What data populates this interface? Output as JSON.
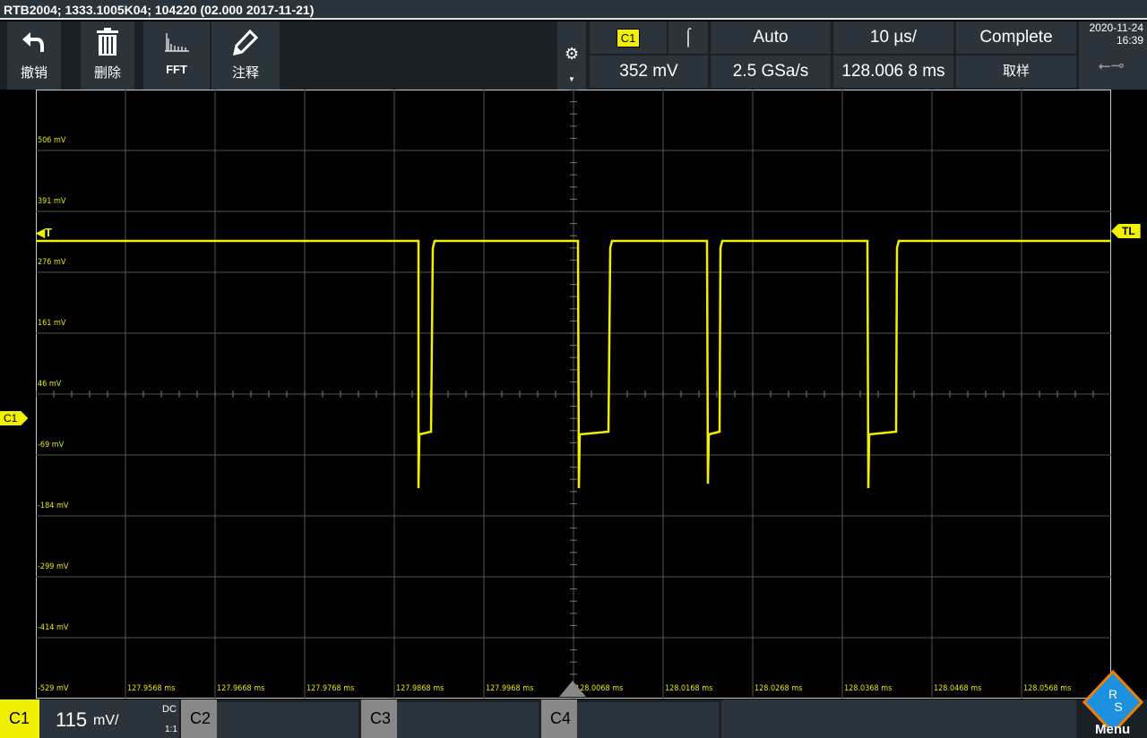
{
  "title": "RTB2004; 1333.1005K04; 104220 (02.000 2017-11-21)",
  "toolbar": [
    {
      "label": "撤销",
      "icon": "undo-icon"
    },
    {
      "label": "删除",
      "icon": "trash-icon"
    },
    {
      "label": "FFT",
      "icon": "fft-icon"
    },
    {
      "label": "注释",
      "icon": "pencil-icon"
    }
  ],
  "trigger": {
    "source": "C1",
    "edge": "rising-edge-icon",
    "mode": "Auto",
    "timebase": "10 µs/",
    "acq_state": "Complete",
    "level": "352 mV",
    "sample_rate": "2.5 GSa/s",
    "position": "128.006 8 ms",
    "acq_mode": "取样"
  },
  "datetime": {
    "date": "2020-11-24",
    "time": "16:39"
  },
  "y_labels": [
    "506 mV",
    "391 mV",
    "276 mV",
    "161 mV",
    "46 mV",
    "-69 mV",
    "-184 mV",
    "-299 mV",
    "-414 mV",
    "-529 mV"
  ],
  "x_labels": [
    "127.9568 ms",
    "127.9668 ms",
    "127.9768 ms",
    "127.9868 ms",
    "127.9968 ms",
    "128.0068 ms",
    "128.0168 ms",
    "128.0268 ms",
    "128.0368 ms",
    "128.0468 ms",
    "128.0568 ms"
  ],
  "markers": {
    "trigger": "T",
    "trigger_level": "TL",
    "channel": "C1"
  },
  "channels": {
    "c1": {
      "label": "C1",
      "scale": "115",
      "unit": "mV/",
      "coupling": "DC",
      "probe": "1:1"
    },
    "c2": "C2",
    "c3": "C3",
    "c4": "C4"
  },
  "menu": "Menu",
  "colors": {
    "c1": "#f0f000",
    "panel": "#2b343a"
  }
}
